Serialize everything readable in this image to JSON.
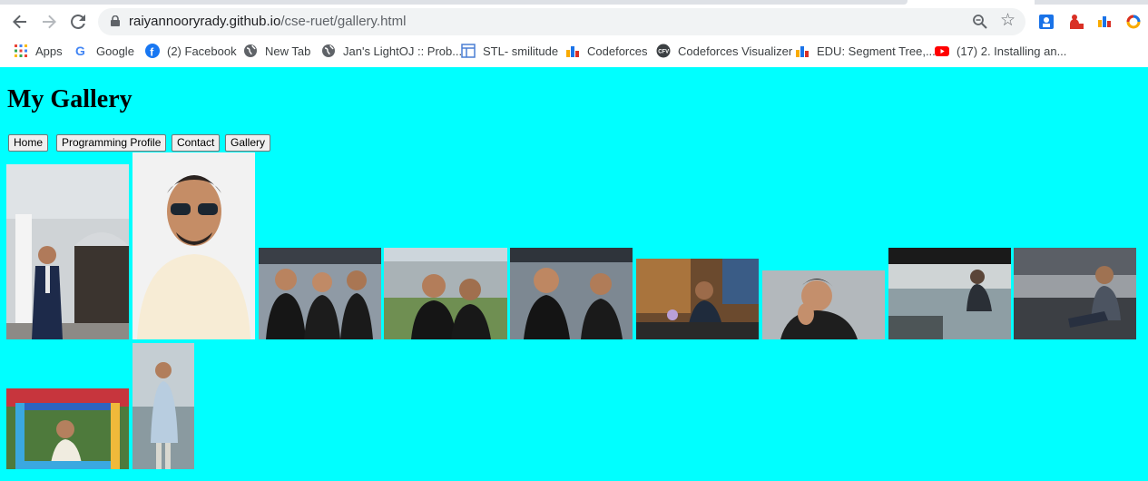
{
  "browser": {
    "url_host": "raiyannooryrady.github.io",
    "url_path": "/cse-ruet/gallery.html",
    "bookmarks": [
      {
        "label": "Apps",
        "icon": "apps-grid-icon"
      },
      {
        "label": "Google",
        "icon": "google-icon"
      },
      {
        "label": "(2) Facebook",
        "icon": "facebook-icon"
      },
      {
        "label": "New Tab",
        "icon": "globe-icon"
      },
      {
        "label": "Jan's LightOJ :: Prob...",
        "icon": "globe-icon"
      },
      {
        "label": "STL- smilitude",
        "icon": "window-icon"
      },
      {
        "label": "Codeforces",
        "icon": "codeforces-icon"
      },
      {
        "label": "Codeforces Visualizer",
        "icon": "cfv-icon"
      },
      {
        "label": "EDU: Segment Tree,...",
        "icon": "codeforces-icon"
      },
      {
        "label": "(17) 2. Installing an...",
        "icon": "youtube-icon"
      }
    ]
  },
  "page": {
    "title": "My Gallery",
    "nav": [
      "Home",
      "Programming Profile",
      "Contact",
      "Gallery"
    ]
  },
  "gallery": [
    {
      "description": "man in suit standing by white pillars"
    },
    {
      "description": "man in cream kurta wearing sunglasses"
    },
    {
      "description": "three students in black t-shirts"
    },
    {
      "description": "two students outdoors on campus"
    },
    {
      "description": "students selfie in black t-shirts"
    },
    {
      "description": "students seated in a room"
    },
    {
      "description": "man resting chin on hand"
    },
    {
      "description": "man on a rooftop overlooking the water"
    },
    {
      "description": "man sitting in a cafe"
    },
    {
      "description": "man posing behind a colorful frame"
    },
    {
      "description": "man in light kurta by the river"
    }
  ]
}
